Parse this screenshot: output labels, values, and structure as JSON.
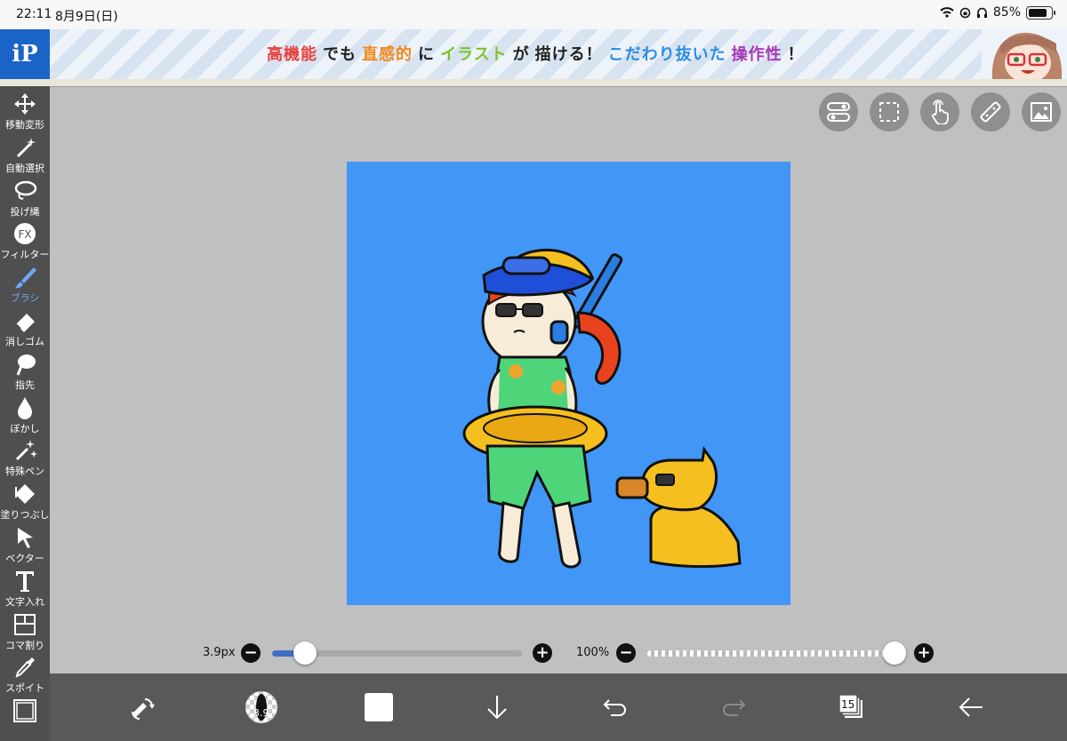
{
  "status_bar": {
    "time": "22:11",
    "date": "8月9日(日)",
    "battery": "85%"
  },
  "banner": {
    "logo": "iP",
    "segments": [
      {
        "text": "高機能",
        "color": "#e8423c"
      },
      {
        "text": "でも",
        "color": "#222222"
      },
      {
        "text": "直感的",
        "color": "#f08a1c"
      },
      {
        "text": "に",
        "color": "#222222"
      },
      {
        "text": "イラスト",
        "color": "#7cc22c"
      },
      {
        "text": "が",
        "color": "#222222"
      },
      {
        "text": "描ける！",
        "color": "#222222"
      },
      {
        "text": "こだわり抜いた",
        "color": "#2c8de0"
      },
      {
        "text": "操作性",
        "color": "#a83ab8"
      },
      {
        "text": "！",
        "color": "#222222"
      }
    ]
  },
  "sidebar": {
    "tools": [
      {
        "label": "移動変形",
        "icon": "move-arrows-icon"
      },
      {
        "label": "自動選択",
        "icon": "magic-wand-icon"
      },
      {
        "label": "投げ縄",
        "icon": "lasso-icon"
      },
      {
        "label": "フィルター",
        "icon": "fx-icon"
      },
      {
        "label": "ブラシ",
        "icon": "brush-icon",
        "active": true
      },
      {
        "label": "消しゴム",
        "icon": "eraser-icon"
      },
      {
        "label": "指先",
        "icon": "smudge-icon"
      },
      {
        "label": "ぼかし",
        "icon": "blur-drop-icon"
      },
      {
        "label": "特殊ペン",
        "icon": "sparkle-pen-icon"
      },
      {
        "label": "塗りつぶし",
        "icon": "bucket-fill-icon"
      },
      {
        "label": "ベクター",
        "icon": "vector-cursor-icon"
      },
      {
        "label": "文字入れ",
        "icon": "text-t-icon"
      },
      {
        "label": "コマ割り",
        "icon": "panel-divide-icon"
      },
      {
        "label": "スポイト",
        "icon": "eyedropper-icon"
      }
    ]
  },
  "top_buttons": [
    "toggle-icon",
    "selection-icon",
    "touch-icon",
    "ruler-icon",
    "image-icon"
  ],
  "brush_size": {
    "label": "3.9px",
    "value_fraction": 0.13
  },
  "opacity": {
    "label": "100%",
    "value_fraction": 0.96
  },
  "bottom_bar": {
    "brush_preview_text": "3.9",
    "layer_count": "15"
  },
  "colors": {
    "canvas_bg": "#4296f5",
    "accent": "#3f6fc4",
    "sidebar": "#4f4f4f",
    "bottombar": "#595959"
  }
}
